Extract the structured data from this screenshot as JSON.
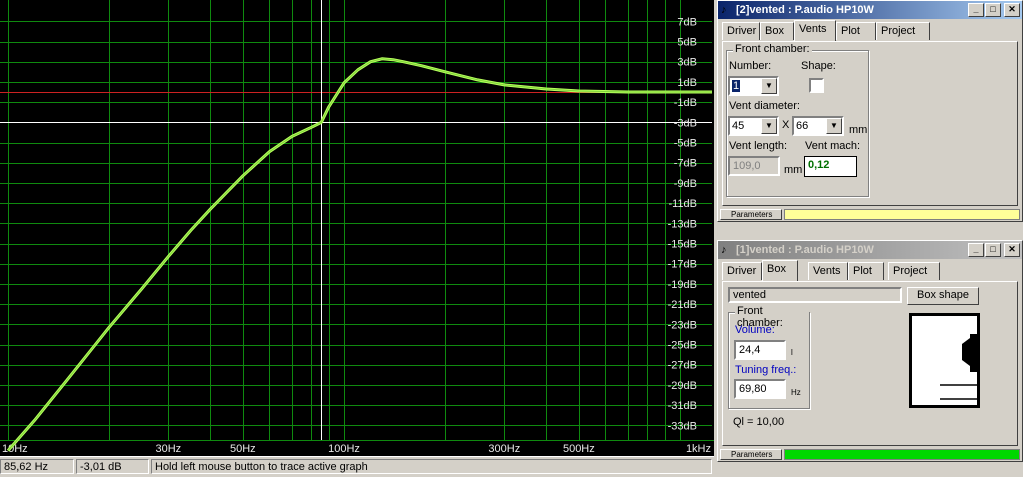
{
  "graph": {
    "background": "#000000",
    "grid_color": "#0f8a0f",
    "zero_line_color": "#cc2222",
    "curve_color": "#b6ff5c",
    "x_labels": [
      "10Hz",
      "30Hz",
      "50Hz",
      "100Hz",
      "300Hz",
      "500Hz",
      "1kHz"
    ],
    "y_labels": [
      "7dB",
      "5dB",
      "3dB",
      "1dB",
      "-1dB",
      "-3dB",
      "-5dB",
      "-7dB",
      "-9dB",
      "-11dB",
      "-13dB",
      "-15dB",
      "-17dB",
      "-19dB",
      "-21dB",
      "-23dB",
      "-25dB",
      "-27dB",
      "-29dB",
      "-31dB",
      "-33dB"
    ],
    "cursor_freq_hz": 85.62,
    "cursor_level_db": -3.01
  },
  "chart_data": {
    "type": "line",
    "xscale": "log",
    "xlim": [
      10,
      1000
    ],
    "ylim": [
      -34,
      8
    ],
    "series": [
      {
        "x": [
          10,
          12,
          15,
          18,
          20,
          25,
          30,
          35,
          40,
          50,
          60,
          70,
          80,
          85.62,
          90,
          100,
          110,
          120,
          130,
          140,
          150,
          170,
          200,
          250,
          300,
          400,
          500,
          700,
          1000
        ],
        "y": [
          -35.5,
          -32.5,
          -28.5,
          -25.2,
          -23.3,
          -19.5,
          -16.3,
          -13.7,
          -11.6,
          -8.3,
          -5.9,
          -4.4,
          -3.5,
          -3.01,
          -1.5,
          0.9,
          2.2,
          3.0,
          3.3,
          3.2,
          3.0,
          2.6,
          2.0,
          1.2,
          0.7,
          0.3,
          0.1,
          0.0,
          0.0
        ]
      }
    ]
  },
  "statusbar": {
    "freq": "85,62 Hz",
    "level": "-3,01 dB",
    "hint": "Hold left mouse button to trace active graph"
  },
  "win_vents": {
    "title": "[2]vented : P.audio HP10W",
    "tabs": [
      "Driver",
      "Box",
      "Vents",
      "Plot",
      "Project"
    ],
    "group_title": "Front chamber:",
    "number_label": "Number:",
    "number_value": "1",
    "shape_label": "Shape:",
    "diameter_label": "Vent diameter:",
    "diameter_a": "45",
    "diameter_x": "X",
    "diameter_b": "66",
    "diameter_unit": "mm",
    "length_label": "Vent length:",
    "length_value": "109,0",
    "length_unit": "mm",
    "mach_label": "Vent mach:",
    "mach_value": "0,12",
    "params_label": "Parameters",
    "params_color": "#ffff99"
  },
  "win_box": {
    "title": "[1]vented : P.audio HP10W",
    "tabs": [
      "Driver",
      "Box",
      "Vents",
      "Plot",
      "Project"
    ],
    "box_type": "vented",
    "box_shape_button": "Box shape",
    "group_title": "Front chamber:",
    "volume_label": "Volume:",
    "volume_value": "24,4",
    "volume_unit": "l",
    "tuning_label": "Tuning freq.:",
    "tuning_value": "69,80",
    "tuning_unit": "Hz",
    "ql_text": "Ql = 10,00",
    "params_label": "Parameters",
    "params_color": "#00d800"
  }
}
